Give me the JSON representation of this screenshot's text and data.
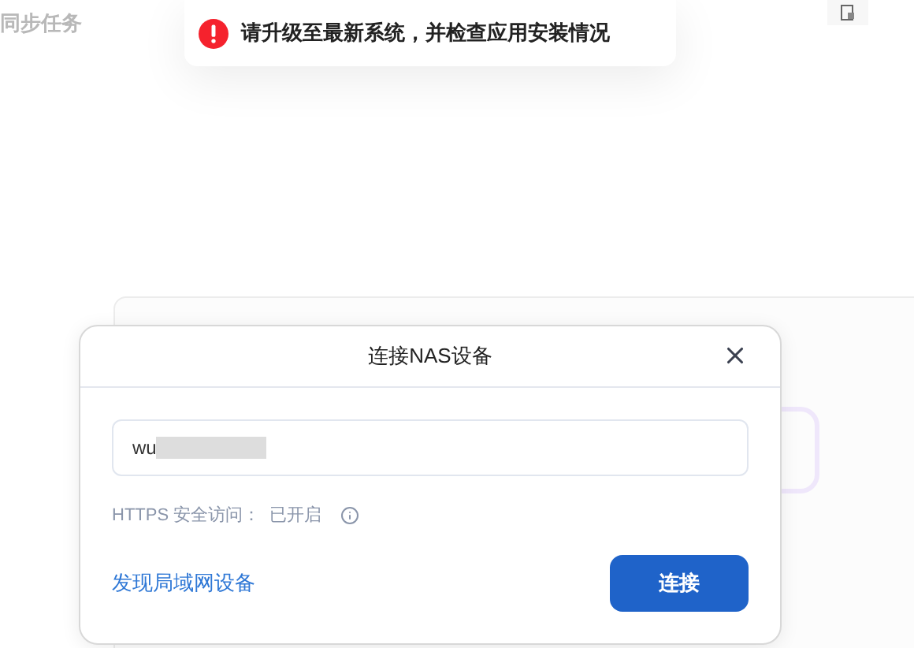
{
  "page": {
    "title": "同步任务"
  },
  "toast": {
    "message": "请升级至最新系统，并检查应用安装情况"
  },
  "dialog": {
    "title": "连接NAS设备",
    "input": {
      "value": "wu"
    },
    "https": {
      "label": "HTTPS 安全访问：",
      "status": "已开启"
    },
    "discover_link": "发现局域网设备",
    "connect_button": "连接"
  }
}
